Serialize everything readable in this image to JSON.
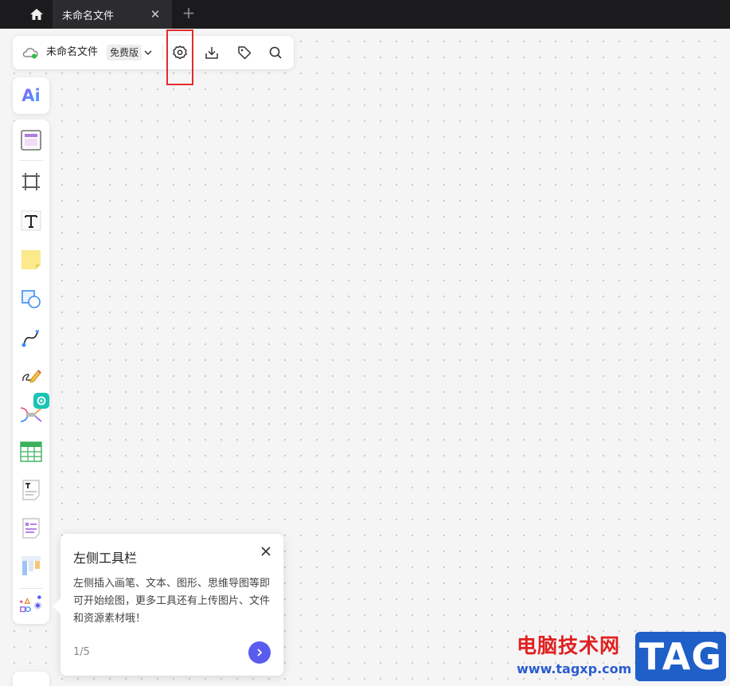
{
  "tabbar": {
    "tab_title": "未命名文件",
    "close_symbol": "✕",
    "new_tab_symbol": "+"
  },
  "topbar": {
    "file_name": "未命名文件",
    "plan_badge": "免费版",
    "icons": [
      "cloud-sync-icon",
      "chevron-down-icon",
      "settings-gear-icon",
      "download-icon",
      "tag-icon",
      "search-icon"
    ]
  },
  "ai_button": {
    "label": "Ai"
  },
  "left_toolbar": {
    "tools": [
      "template-icon",
      "frame-icon",
      "text-icon",
      "sticky-note-icon",
      "shape-icon",
      "connector-icon",
      "pen-icon",
      "mindmap-icon",
      "table-icon",
      "text-doc-icon",
      "list-card-icon",
      "kanban-icon",
      "more-tools-icon"
    ]
  },
  "guide": {
    "title": "左侧工具栏",
    "body": "左侧插入画笔、文本、图形、思维导图等即可开始绘图，更多工具还有上传图片、文件和资源素材哦！",
    "step": "1/5"
  },
  "watermark": {
    "cn": "电脑技术网",
    "url": "www.tagxp.com",
    "tag": "TAG"
  },
  "colors": {
    "accent": "#5a5cf0",
    "highlight": "#e22b2b",
    "mindmap_badge": "#1cc4b4"
  }
}
